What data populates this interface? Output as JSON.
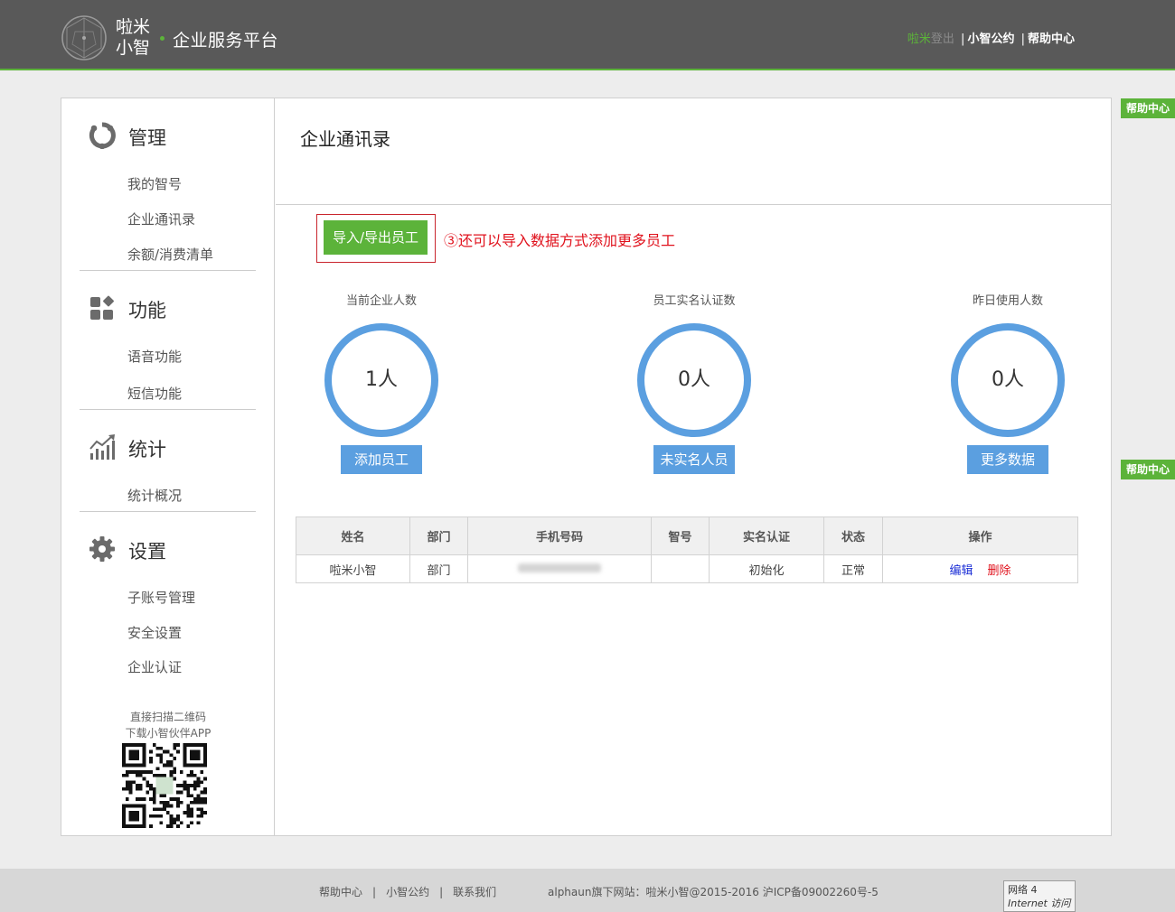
{
  "header": {
    "logo_text": "啦米小智",
    "platform_title": "企业服务平台",
    "user_name": "啦米",
    "logout_label": "登出",
    "link_convention": "小智公约",
    "link_help": "帮助中心"
  },
  "float_help": {
    "top_label": "帮助中心",
    "bottom_label": "帮助中心"
  },
  "sidebar": {
    "sections": [
      {
        "title": "管理",
        "icon": "manage-icon",
        "items": [
          "我的智号",
          "企业通讯录",
          "余额/消费清单"
        ]
      },
      {
        "title": "功能",
        "icon": "function-icon",
        "items": [
          "语音功能",
          "短信功能"
        ]
      },
      {
        "title": "统计",
        "icon": "stats-icon",
        "items": [
          "统计概况"
        ]
      },
      {
        "title": "设置",
        "icon": "gear-icon",
        "items": [
          "子账号管理",
          "安全设置",
          "企业认证"
        ]
      }
    ],
    "qr_caption_line1": "直接扫描二维码",
    "qr_caption_line2": "下载小智伙伴APP"
  },
  "main": {
    "page_title": "企业通讯录",
    "import_button": "导入/导出员工",
    "import_tip": "③还可以导入数据方式添加更多员工",
    "stats": [
      {
        "label": "当前企业人数",
        "value": "1人",
        "button": "添加员工"
      },
      {
        "label": "员工实名认证数",
        "value": "0人",
        "button": "未实名人员"
      },
      {
        "label": "昨日使用人数",
        "value": "0人",
        "button": "更多数据"
      }
    ],
    "table": {
      "headers": [
        "姓名",
        "部门",
        "手机号码",
        "智号",
        "实名认证",
        "状态",
        "操作"
      ],
      "rows": [
        {
          "name": "啦米小智",
          "dept": "部门",
          "phone": "",
          "zhihao": "",
          "auth": "初始化",
          "status": "正常",
          "edit": "编辑",
          "delete": "删除"
        }
      ]
    }
  },
  "footer": {
    "links": [
      "帮助中心",
      "小智公约",
      "联系我们"
    ],
    "copyright": "alphaun旗下网站：啦米小智@2015-2016 沪ICP备09002260号-5",
    "ie_status_line1": "网络 4",
    "ie_status_line2": "Internet 访问"
  },
  "colors": {
    "header_bg": "#595959",
    "brand_green": "#5cb33a",
    "stat_blue": "#5b9fe0",
    "alert_red": "#e0111c",
    "link_blue": "#1b2ed6"
  }
}
